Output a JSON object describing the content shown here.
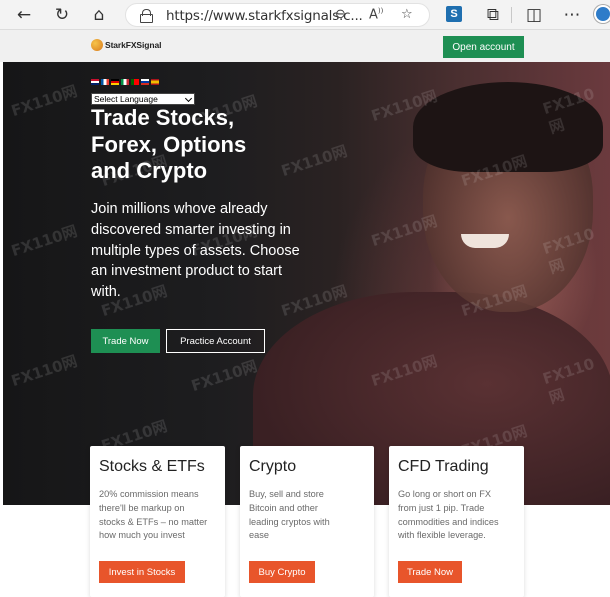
{
  "browser": {
    "url": "https://www.starkfxsignals.c...",
    "reader_label": "A",
    "icons": [
      "back-icon",
      "refresh-icon",
      "home-icon",
      "lock-icon",
      "zoom-icon",
      "read-aloud-icon",
      "favorite-icon",
      "extension-icon",
      "split-screen-icon",
      "more-icon",
      "profile-icon"
    ]
  },
  "site": {
    "logo_text": "StarkFXSignal",
    "open_account_label": "Open account"
  },
  "hero": {
    "language_select": "Select Language",
    "title_lines": [
      "Trade Stocks,",
      "Forex, Options",
      "and Crypto"
    ],
    "subtitle_lines": [
      "Join millions whove already",
      "discovered smarter investing in",
      "multiple types of assets. Choose",
      "an investment product to start",
      "with."
    ],
    "trade_now_label": "Trade Now",
    "practice_label": "Practice Account"
  },
  "cards": [
    {
      "title": "Stocks & ETFs",
      "desc_lines": [
        "20% commission means",
        "there'll be markup on",
        "stocks & ETFs – no matter",
        "how much you invest"
      ],
      "button": "Invest in Stocks"
    },
    {
      "title": "Crypto",
      "desc_lines": [
        "Buy, sell and store",
        "Bitcoin and other",
        "leading cryptos with",
        "ease"
      ],
      "button": "Buy Crypto"
    },
    {
      "title": "CFD Trading",
      "desc_lines": [
        "Go long or short on FX",
        "from just 1 pip. Trade",
        "commodities and indices",
        "with flexible leverage."
      ],
      "button": "Trade Now"
    }
  ],
  "watermark": "FX110网",
  "colors": {
    "green": "#1e8f53",
    "orange": "#e8552b"
  }
}
